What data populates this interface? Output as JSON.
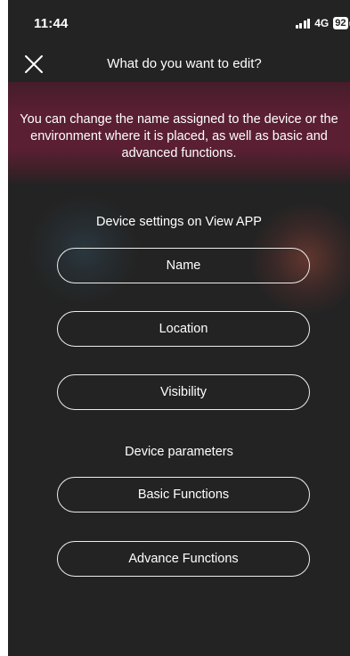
{
  "status_bar": {
    "time": "11:44",
    "network": "4G",
    "battery": "92"
  },
  "header": {
    "title": "What do you want to edit?",
    "close_icon": "close-icon"
  },
  "banner": {
    "text": "You can change the name assigned to the device or the environment where it is placed, as well as basic and advanced functions."
  },
  "device_settings": {
    "title": "Device settings on View APP",
    "buttons": [
      {
        "label": "Name"
      },
      {
        "label": "Location"
      },
      {
        "label": "Visibility"
      }
    ]
  },
  "device_parameters": {
    "title": "Device parameters",
    "buttons": [
      {
        "label": "Basic Functions"
      },
      {
        "label": "Advance Functions"
      }
    ]
  },
  "colors": {
    "background": "#232323",
    "banner": "#5a1f33",
    "text": "#ffffff",
    "button_border": "#ededed"
  }
}
